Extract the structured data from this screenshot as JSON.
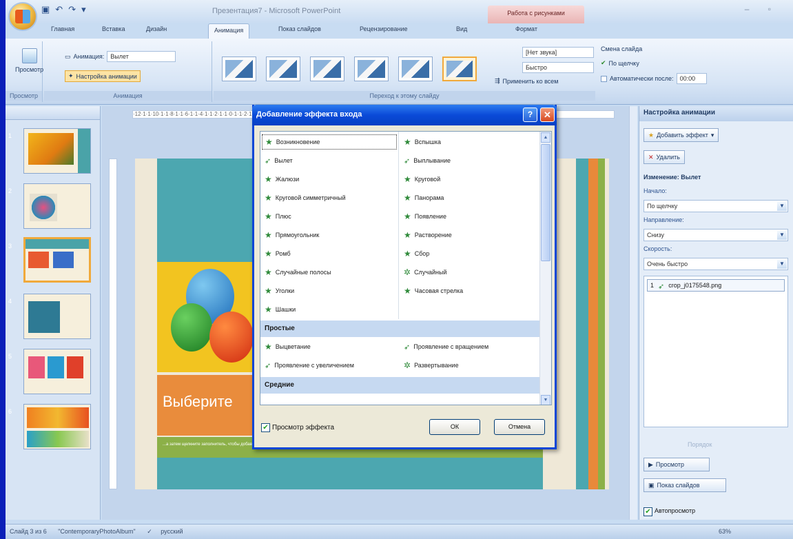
{
  "window": {
    "title": "Презентация7 - Microsoft PowerPoint",
    "context_tab": "Работа с рисунками"
  },
  "tabs": [
    "Главная",
    "Вставка",
    "Дизайн",
    "Анимация",
    "Показ слайдов",
    "Рецензирование",
    "Вид",
    "Формат"
  ],
  "ribbon": {
    "preview_label": "Просмотр",
    "animation_label": "Анимация:",
    "animation_value": "Вылет",
    "custom_anim": "Настройка анимации",
    "group_preview": "Просмотр",
    "group_anim": "Анимация",
    "group_transition": "Переход к этому слайду",
    "sound_value": "[Нет звука]",
    "speed_value": "Быстро",
    "apply_all": "Применить ко всем",
    "change_slide": "Смена слайда",
    "on_click": "По щелчку",
    "auto_after": "Автоматически после:",
    "auto_time": "00:00"
  },
  "slides": [
    {
      "num": "1"
    },
    {
      "num": "2"
    },
    {
      "num": "3"
    },
    {
      "num": "4"
    },
    {
      "num": "5"
    },
    {
      "num": "6"
    }
  ],
  "slide": {
    "title": "Выберите",
    "subtitle": "...а затем щелкните заполнитель, чтобы добавить рисунок и надпись."
  },
  "dialog": {
    "title": "Добавление эффекта входа",
    "col1": [
      "Возникновение",
      "Вылет",
      "Жалюзи",
      "Круговой симметричный",
      "Плюс",
      "Прямоугольник",
      "Ромб",
      "Случайные полосы",
      "Уголки",
      "Шашки"
    ],
    "col2": [
      "Вспышка",
      "Выплывание",
      "Круговой",
      "Панорама",
      "Появление",
      "Растворение",
      "Сбор",
      "Случайный",
      "Часовая стрелка"
    ],
    "group_simple": "Простые",
    "simple1": [
      "Выцветание",
      "Проявление с увеличением"
    ],
    "simple2": [
      "Проявление с вращением",
      "Развертывание"
    ],
    "group_medium": "Средние",
    "preview_effect": "Просмотр эффекта",
    "ok": "ОК",
    "cancel": "Отмена"
  },
  "taskpane": {
    "title": "Настройка анимации",
    "add_effect": "Добавить эффект",
    "remove": "Удалить",
    "change_label": "Изменение: Вылет",
    "start_label": "Начало:",
    "start_value": "По щелчку",
    "direction_label": "Направление:",
    "direction_value": "Снизу",
    "speed_label": "Скорость:",
    "speed_value": "Очень быстро",
    "item_num": "1",
    "item_name": "crop_j0175548.png",
    "reorder": "Порядок",
    "play": "Просмотр",
    "slideshow": "Показ слайдов",
    "autopreview": "Автопросмотр"
  },
  "status": {
    "slide": "Слайд 3 из 6",
    "theme": "\"ContemporaryPhotoAlbum\"",
    "lang": "русский",
    "zoom": "63%"
  }
}
